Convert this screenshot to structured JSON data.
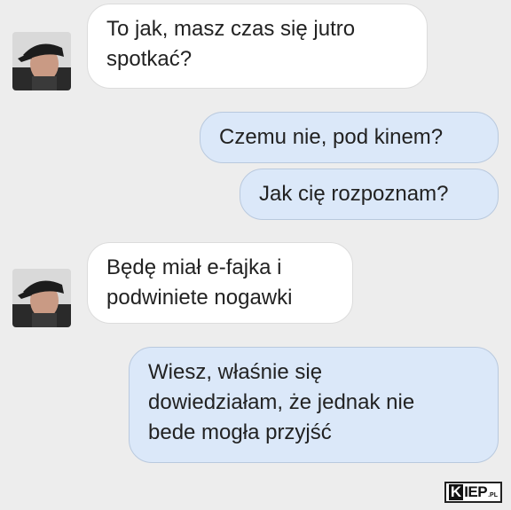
{
  "messages": [
    {
      "direction": "incoming",
      "lines": [
        "To jak, masz czas się jutro",
        "spotkać?"
      ]
    },
    {
      "direction": "outgoing",
      "lines": [
        "Czemu nie, pod kinem?"
      ]
    },
    {
      "direction": "outgoing",
      "lines": [
        "Jak cię rozpoznam?"
      ]
    },
    {
      "direction": "incoming",
      "lines": [
        "Będę miał e-fajka i",
        "podwiniete nogawki"
      ]
    },
    {
      "direction": "outgoing",
      "lines": [
        "Wiesz, właśnie się",
        "dowiedziałam, że jednak nie",
        "bede mogła przyjść"
      ]
    }
  ],
  "watermark": {
    "k": "K",
    "iep": "IEP",
    "pl": ".PL"
  },
  "colors": {
    "background": "#ededed",
    "incoming_bubble": "#ffffff",
    "outgoing_bubble": "#dbe8f9",
    "text": "#222222"
  },
  "icons": {
    "avatar": "user-avatar-photo"
  }
}
